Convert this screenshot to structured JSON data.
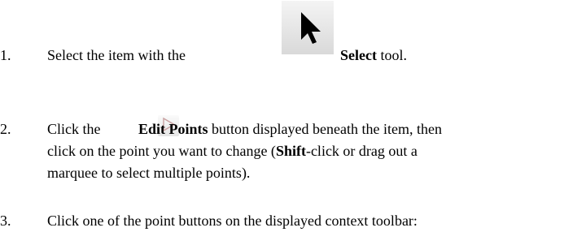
{
  "steps": [
    {
      "number": "1.",
      "before": "Select the item with the",
      "icon": "select-arrow-icon",
      "bold": "Select",
      "after": " tool."
    },
    {
      "number": "2.",
      "before": "Click the",
      "icon": "edit-points-icon",
      "bold": "Edit Points",
      "after": " button displayed beneath the item, then",
      "line2_before": "click on the point you want to change (",
      "line2_bold": "Shift",
      "line2_after": "-click or drag out a",
      "line3": "marquee to select multiple points)."
    },
    {
      "number": "3.",
      "text": "Click one of the point buttons on the displayed context toolbar:"
    }
  ]
}
